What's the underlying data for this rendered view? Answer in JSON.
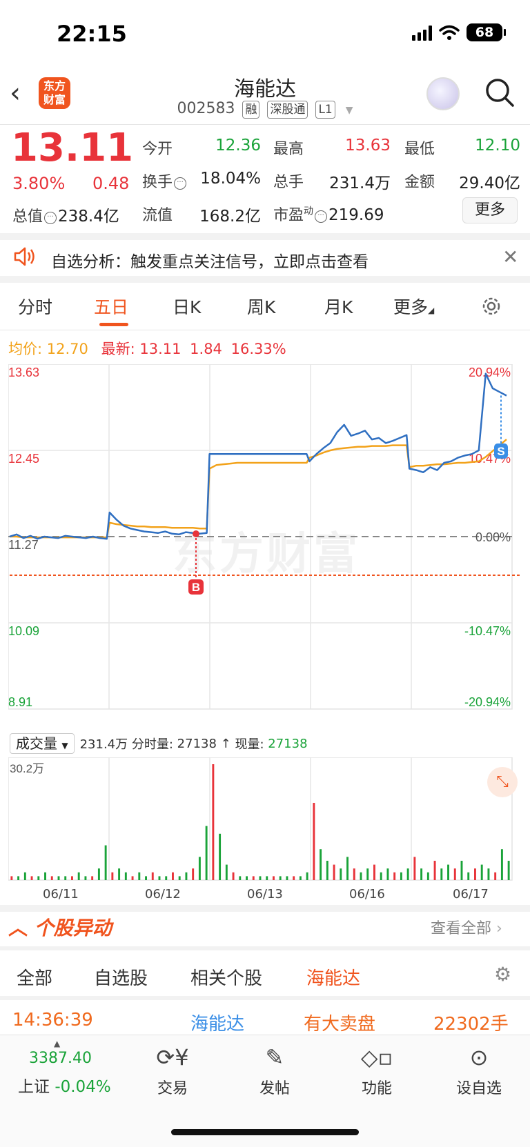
{
  "status": {
    "time": "22:15",
    "battery": "68"
  },
  "header": {
    "logo_line1": "东方",
    "logo_line2": "财富",
    "name": "海能达",
    "code": "002583",
    "tags": [
      "融",
      "深股通",
      "L1"
    ]
  },
  "quote": {
    "price": "13.11",
    "change_pct": "3.80%",
    "change": "0.48",
    "open_label": "今开",
    "open": "12.36",
    "high_label": "最高",
    "high": "13.63",
    "low_label": "最低",
    "low": "12.10",
    "turnover_label": "换手",
    "turnover": "18.04%",
    "volume_label": "总手",
    "volume": "231.4万",
    "amount_label": "金额",
    "amount": "29.40亿",
    "mktcap_label": "总值",
    "mktcap": "238.4亿",
    "float_label": "流值",
    "float_cap": "168.2亿",
    "pe_label": "市盈",
    "pe_sup": "动",
    "pe": "219.69",
    "more": "更多"
  },
  "notice": {
    "text": "自选分析：触发重点关注信号，立即点击查看"
  },
  "period_tabs": [
    "分时",
    "五日",
    "日K",
    "周K",
    "月K",
    "更多"
  ],
  "period_active": "五日",
  "legend": {
    "avg_label": "均价:",
    "avg": "12.70",
    "latest_label": "最新:",
    "latest": "13.11",
    "latest_change": "1.84",
    "latest_pct": "16.33%"
  },
  "chart_data": {
    "type": "line",
    "dates": [
      "06/11",
      "06/12",
      "06/13",
      "06/16",
      "06/17"
    ],
    "y_left_ticks": [
      "13.63",
      "12.45",
      "11.27",
      "10.09",
      "8.91"
    ],
    "y_right_ticks": [
      "20.94%",
      "10.47%",
      "0.00%",
      "-10.47%",
      "-20.94%"
    ],
    "ylim": [
      8.91,
      13.63
    ],
    "prev_close": 11.27,
    "buy_marker": "B",
    "sell_marker": "S",
    "series": [
      {
        "name": "price",
        "color": "#2f6fc1",
        "values": [
          11.27,
          11.3,
          11.25,
          11.28,
          11.24,
          11.27,
          11.26,
          11.25,
          11.28,
          11.27,
          11.26,
          11.25,
          11.27,
          11.25,
          11.24,
          11.6,
          11.5,
          11.42,
          11.38,
          11.36,
          11.34,
          11.33,
          11.32,
          11.34,
          11.31,
          11.3,
          11.33,
          11.32,
          11.31,
          11.32,
          12.4,
          12.4,
          12.4,
          12.4,
          12.4,
          12.4,
          12.4,
          12.4,
          12.4,
          12.4,
          12.4,
          12.4,
          12.4,
          12.4,
          12.4,
          12.3,
          12.4,
          12.48,
          12.55,
          12.7,
          12.8,
          12.65,
          12.68,
          12.72,
          12.6,
          12.62,
          12.55,
          12.58,
          12.62,
          12.66,
          12.2,
          12.18,
          12.15,
          12.22,
          12.18,
          12.28,
          12.3,
          12.35,
          12.38,
          12.4,
          12.45,
          13.5,
          13.3,
          13.25,
          13.2
        ]
      },
      {
        "name": "avg",
        "color": "#f2a21a",
        "values": [
          11.27,
          11.27,
          11.26,
          11.26,
          11.26,
          11.26,
          11.26,
          11.26,
          11.26,
          11.26,
          11.26,
          11.26,
          11.26,
          11.26,
          11.26,
          11.46,
          11.44,
          11.43,
          11.42,
          11.41,
          11.41,
          11.4,
          11.4,
          11.4,
          11.39,
          11.39,
          11.39,
          11.39,
          11.38,
          11.38,
          12.2,
          12.25,
          12.26,
          12.27,
          12.28,
          12.28,
          12.28,
          12.28,
          12.28,
          12.28,
          12.28,
          12.28,
          12.28,
          12.28,
          12.28,
          12.35,
          12.38,
          12.42,
          12.45,
          12.47,
          12.48,
          12.49,
          12.5,
          12.5,
          12.51,
          12.51,
          12.51,
          12.52,
          12.52,
          12.52,
          12.22,
          12.24,
          12.24,
          12.25,
          12.26,
          12.26,
          12.27,
          12.28,
          12.28,
          12.29,
          12.3,
          12.36,
          12.44,
          12.52,
          12.6
        ]
      }
    ]
  },
  "volume": {
    "selector": "成交量",
    "total": "231.4万",
    "interval_label": "分时量:",
    "interval": "27138",
    "current_label": "现量:",
    "current": "27138",
    "max_label": "30.2万",
    "bars": [
      1,
      1,
      2,
      1,
      1,
      2,
      1,
      1,
      1,
      1,
      2,
      1,
      1,
      3,
      9,
      2,
      3,
      2,
      1,
      2,
      1,
      2,
      1,
      1,
      2,
      1,
      2,
      3,
      6,
      14,
      30,
      12,
      4,
      2,
      1,
      1,
      1,
      1,
      1,
      1,
      1,
      1,
      1,
      1,
      2,
      20,
      8,
      5,
      4,
      3,
      6,
      3,
      2,
      3,
      4,
      2,
      3,
      2,
      2,
      3,
      6,
      3,
      2,
      5,
      3,
      4,
      3,
      5,
      2,
      3,
      4,
      3,
      2,
      8,
      5
    ]
  },
  "movers": {
    "title": "个股异动",
    "view_all": "查看全部",
    "tabs": [
      "全部",
      "自选股",
      "相关个股",
      "海能达"
    ],
    "active_tab": "海能达",
    "row": {
      "time": "14:36:39",
      "name": "海能达",
      "event": "有大卖盘",
      "amount": "22302手"
    }
  },
  "bottom_nav": {
    "index_value": "3387.40",
    "index_name": "上证",
    "index_change": "-0.04%",
    "items": [
      {
        "label": "交易",
        "icon": "trade-icon"
      },
      {
        "label": "发帖",
        "icon": "post-icon"
      },
      {
        "label": "功能",
        "icon": "apps-icon"
      },
      {
        "label": "设自选",
        "icon": "add-watch-icon"
      }
    ]
  }
}
